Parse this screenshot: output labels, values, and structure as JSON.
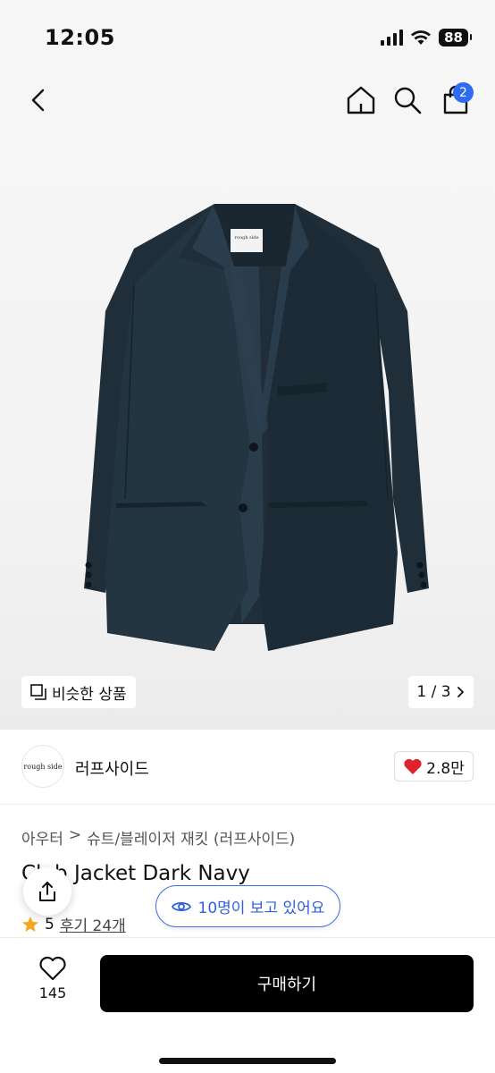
{
  "status": {
    "time": "12:05",
    "battery": "88"
  },
  "nav": {
    "cart_count": "2"
  },
  "image": {
    "brand_tag": "rough side",
    "similar_label": "비슷한 상품",
    "pager": "1 / 3"
  },
  "brand": {
    "logo_text": "rough side",
    "name": "러프사이드",
    "likes": "2.8만"
  },
  "breadcrumb": {
    "items": [
      "아우터",
      "슈트/블레이저 재킷 (러프사이드)"
    ],
    "separator": ">"
  },
  "product": {
    "title": "Club Jacket Dark Navy",
    "rating": "5",
    "reviews": "후기 24개"
  },
  "viewers": {
    "label": "10명이 보고 있어요"
  },
  "bottom": {
    "wish_count": "145",
    "buy_label": "구매하기"
  },
  "colors": {
    "accent": "#2f6bf0",
    "viewers_border": "#3e6fe6",
    "heart": "#e0222a",
    "star": "#f5a623",
    "jacket": "#1f2e38"
  },
  "icons": [
    "back-icon",
    "home-icon",
    "search-icon",
    "shopping-bag-icon",
    "similar-icon",
    "chevron-right-icon",
    "heart-icon",
    "star-icon",
    "share-icon",
    "eye-icon",
    "wishlist-heart-icon"
  ]
}
